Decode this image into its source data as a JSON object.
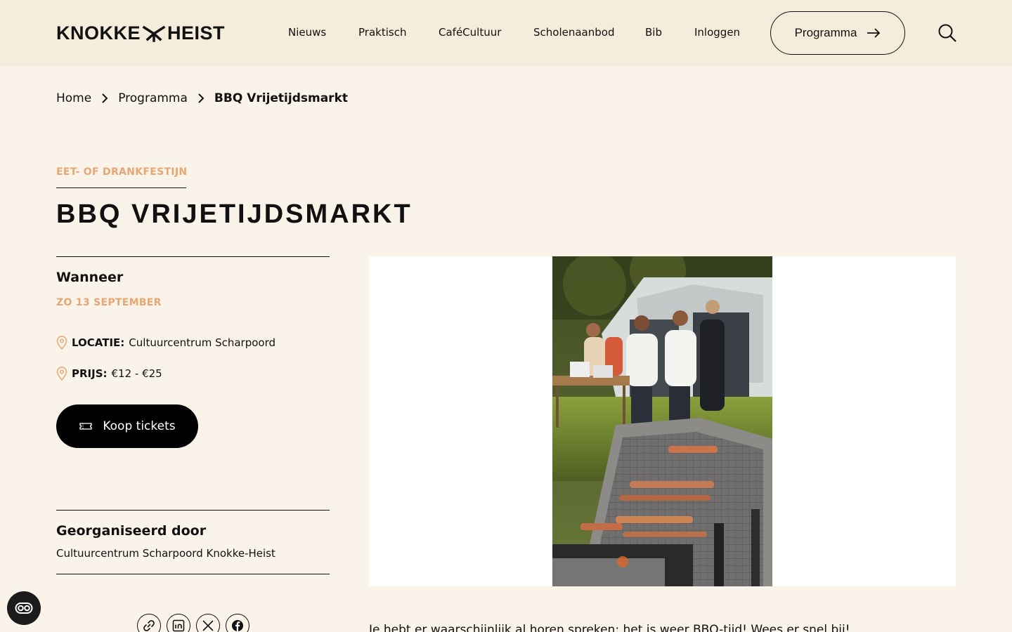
{
  "brand": {
    "logo_left": "KNOKKE",
    "logo_right": "HEIST",
    "accent": "#e8a673",
    "header_bg": "#f5ecdc",
    "page_bg": "#faf3ea"
  },
  "nav": {
    "items": [
      "Nieuws",
      "Praktisch",
      "CaféCultuur",
      "Scholenaanbod",
      "Bib",
      "Inloggen"
    ],
    "programma_button": "Programma",
    "search_icon": "search-icon"
  },
  "breadcrumb": {
    "items": [
      "Home",
      "Programma"
    ],
    "current": "BBQ Vrijetijdsmarkt"
  },
  "event": {
    "category": "EET- OF DRANKFESTIJN",
    "title": "BBQ VRIJETIJDSMARKT",
    "when_heading": "Wanneer",
    "date": "ZO 13 SEPTEMBER",
    "location_label": "LOCATIE:",
    "location_value": "Cultuurcentrum Scharpoord",
    "price_label": "PRIJS:",
    "price_value": "€12 - €25",
    "buy_label": "Koop tickets",
    "organizer_heading": "Georganiseerd door",
    "organizer_name": "Cultuurcentrum Scharpoord Knokke-Heist"
  },
  "share": [
    "link-icon",
    "linkedin-icon",
    "x-icon",
    "facebook-icon"
  ],
  "body_text": "Je hebt er waarschijnlijk al horen spreken: het is weer BBQ-tijd! Wees er snel bij!"
}
